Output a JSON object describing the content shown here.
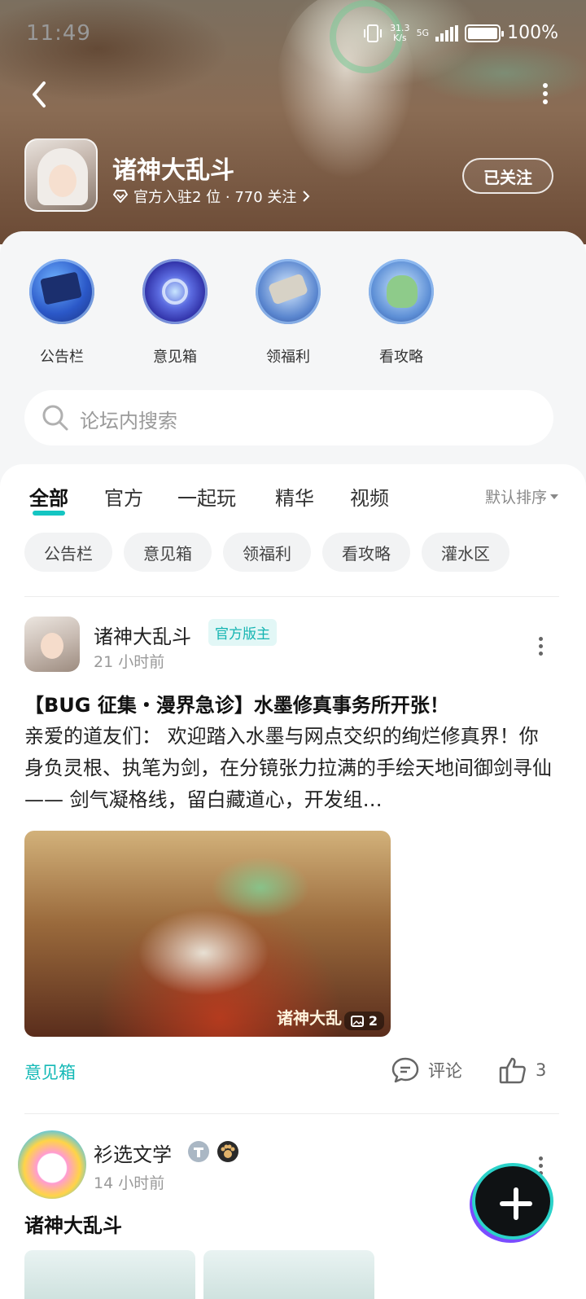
{
  "status_bar": {
    "time": "11:49",
    "net_speed_value": "31.3",
    "net_speed_unit": "K/s",
    "network": "5G",
    "battery": "100%"
  },
  "header": {
    "game_name": "诸神大乱斗",
    "meta": "官方入驻2 位 · 770 关注",
    "follow_label": "已关注"
  },
  "shortcuts": [
    {
      "label": "公告栏",
      "icon": "bulletin-icon"
    },
    {
      "label": "意见箱",
      "icon": "feedback-icon"
    },
    {
      "label": "领福利",
      "icon": "welfare-icon"
    },
    {
      "label": "看攻略",
      "icon": "guide-icon"
    }
  ],
  "search": {
    "placeholder": "论坛内搜索"
  },
  "tabs": [
    "全部",
    "官方",
    "一起玩",
    "精华",
    "视频"
  ],
  "sort_label": "默认排序",
  "chips": [
    "公告栏",
    "意见箱",
    "领福利",
    "看攻略",
    "灌水区"
  ],
  "posts": [
    {
      "author": "诸神大乱斗",
      "badge": "官方版主",
      "time": "21 小时前",
      "title": "【BUG 征集・漫界急诊】水墨修真事务所开张！",
      "body": "亲爱的道友们： 欢迎踏入水墨与网点交织的绚烂修真界！你身负灵根、执笔为剑，在分镜张力拉满的手绘天地间御剑寻仙 —— 剑气凝格线，留白藏道心，开发组…",
      "image_watermark": "诸神大乱",
      "image_count": "2",
      "tag": "意见箱",
      "comment_label": "评论",
      "like_count": "3"
    },
    {
      "author": "衫选文学",
      "time": "14 小时前",
      "title": "诸神大乱斗"
    }
  ],
  "colors": {
    "accent": "#14c5c2",
    "page_bg": "#f5f6f7"
  }
}
